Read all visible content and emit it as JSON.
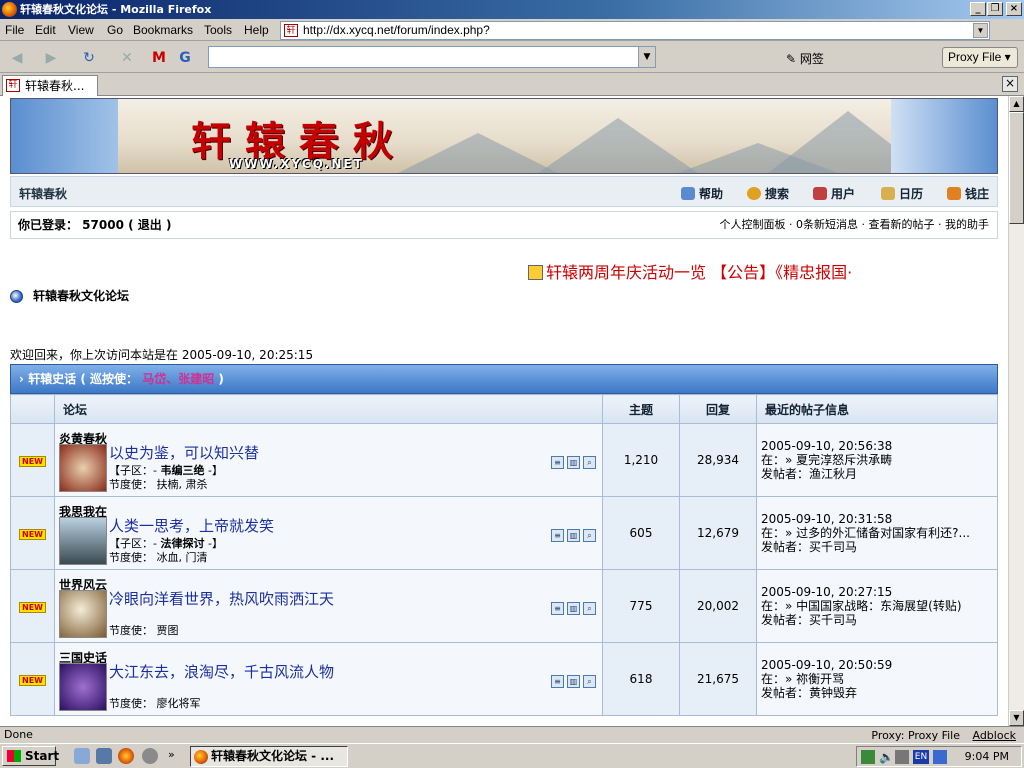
{
  "window": {
    "title": "轩辕春秋文化论坛 - Mozilla Firefox"
  },
  "menu": [
    "File",
    "Edit",
    "View",
    "Go",
    "Bookmarks",
    "Tools",
    "Help"
  ],
  "url": "http://dx.xycq.net/forum/index.php?",
  "toolbar": {
    "wangqian": "网签",
    "proxy_button": "Proxy File"
  },
  "tab": {
    "label": "轩辕春秋..."
  },
  "banner": {
    "logo": "轩辕春秋",
    "site": "WWW.XYCQ.NET"
  },
  "nav": {
    "home": "轩辕春秋",
    "links": [
      "帮助",
      "搜索",
      "用户",
      "日历",
      "钱庄"
    ]
  },
  "login": {
    "text": "你已登录： 57000 ( 退出 )",
    "links": "个人控制面板 · 0条新短消息 · 查看新的帖子 · 我的助手"
  },
  "marquee": "轩辕两周年庆活动一览 【公告】《精忠报国·",
  "forum_title": "轩辕春秋文化论坛",
  "welcome": "欢迎回来，你上次访问本站是在 2005-09-10, 20:25:15",
  "category": {
    "name": "轩辕史话",
    "mod_prefix": "( 巡按使：",
    "mods": "马岱、张建昭",
    "mod_suffix": ")"
  },
  "table": {
    "headers": {
      "forum": "论坛",
      "topics": "主题",
      "replies": "回复",
      "last": "最近的帖子信息"
    },
    "rows": [
      {
        "new": "NEW",
        "name": "炎黄春秋",
        "desc": "以史为鉴，可以知兴替",
        "sub_prefix": "【子区：-",
        "sub": "韦编三绝",
        "sub_suffix": "-】",
        "mod": "节度使： 扶楠, 肃杀",
        "topics": "1,210",
        "replies": "28,934",
        "date": "2005-09-10, 20:56:38",
        "in": "在：» 夏完淳怒斥洪承畴",
        "poster": "发帖者：渔江秋月"
      },
      {
        "new": "NEW",
        "name": "我思我在",
        "desc": "人类一思考，上帝就发笑",
        "sub_prefix": "【子区：-",
        "sub": "法律探讨",
        "sub_suffix": "-】",
        "mod": "节度使： 冰血, 门清",
        "topics": "605",
        "replies": "12,679",
        "date": "2005-09-10, 20:31:58",
        "in": "在：» 过多的外汇储备对国家有利还?...",
        "poster": "发帖者：买千司马"
      },
      {
        "new": "NEW",
        "name": "世界风云",
        "desc": "冷眼向洋看世界，热风吹雨洒江天",
        "sub_prefix": "",
        "sub": "",
        "sub_suffix": "",
        "mod": "节度使： 贾图",
        "topics": "775",
        "replies": "20,002",
        "date": "2005-09-10, 20:27:15",
        "in": "在：» 中国国家战略：东海展望(转贴)",
        "poster": "发帖者：买千司马"
      },
      {
        "new": "NEW",
        "name": "三国史话",
        "desc": "大江东去，浪淘尽，千古风流人物",
        "sub_prefix": "",
        "sub": "",
        "sub_suffix": "",
        "mod": "节度使： 廖化将军",
        "topics": "618",
        "replies": "21,675",
        "date": "2005-09-10, 20:50:59",
        "in": "在：» 祢衡开骂",
        "poster": "发帖者：黄钟毁弃"
      }
    ]
  },
  "status": {
    "left": "Done",
    "proxy": "Proxy: Proxy File",
    "adblock": "Adblock"
  },
  "taskbar": {
    "start": "Start",
    "item": "轩辕春秋文化论坛 - ...",
    "clock": "9:04 PM",
    "lang": "EN"
  }
}
